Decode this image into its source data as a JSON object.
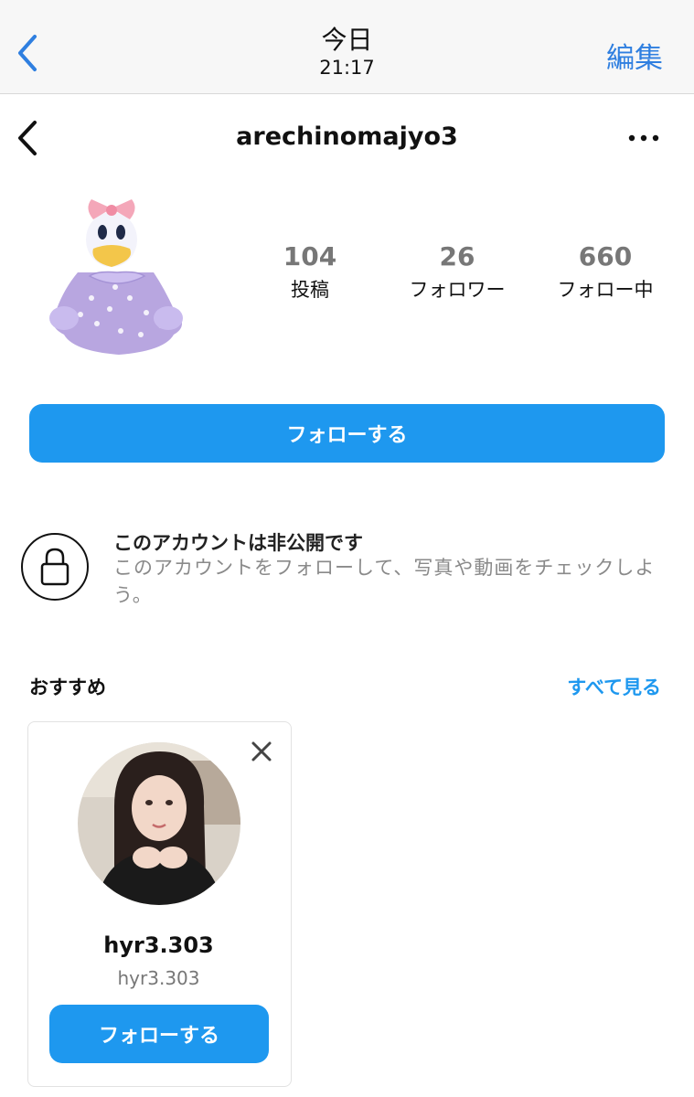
{
  "photos_bar": {
    "title": "今日",
    "time": "21:17",
    "edit_label": "編集"
  },
  "profile": {
    "username": "arechinomajyo3",
    "stats": [
      {
        "value": "104",
        "label": "投稿"
      },
      {
        "value": "26",
        "label": "フォロワー"
      },
      {
        "value": "660",
        "label": "フォロー中"
      }
    ],
    "follow_label": "フォローする"
  },
  "private_notice": {
    "title": "このアカウントは非公開です",
    "description": "このアカウントをフォローして、写真や動画をチェックしよう。"
  },
  "suggestions": {
    "title": "おすすめ",
    "see_all_label": "すべて見る",
    "cards": [
      {
        "name": "hyr3.303",
        "handle": "hyr3.303",
        "follow_label": "フォローする"
      }
    ]
  },
  "colors": {
    "accent": "#1e98ef",
    "ios_blue": "#2f7fe0"
  },
  "icons": [
    "chevron-left-icon",
    "more-horizontal-icon",
    "lock-icon",
    "close-icon"
  ]
}
